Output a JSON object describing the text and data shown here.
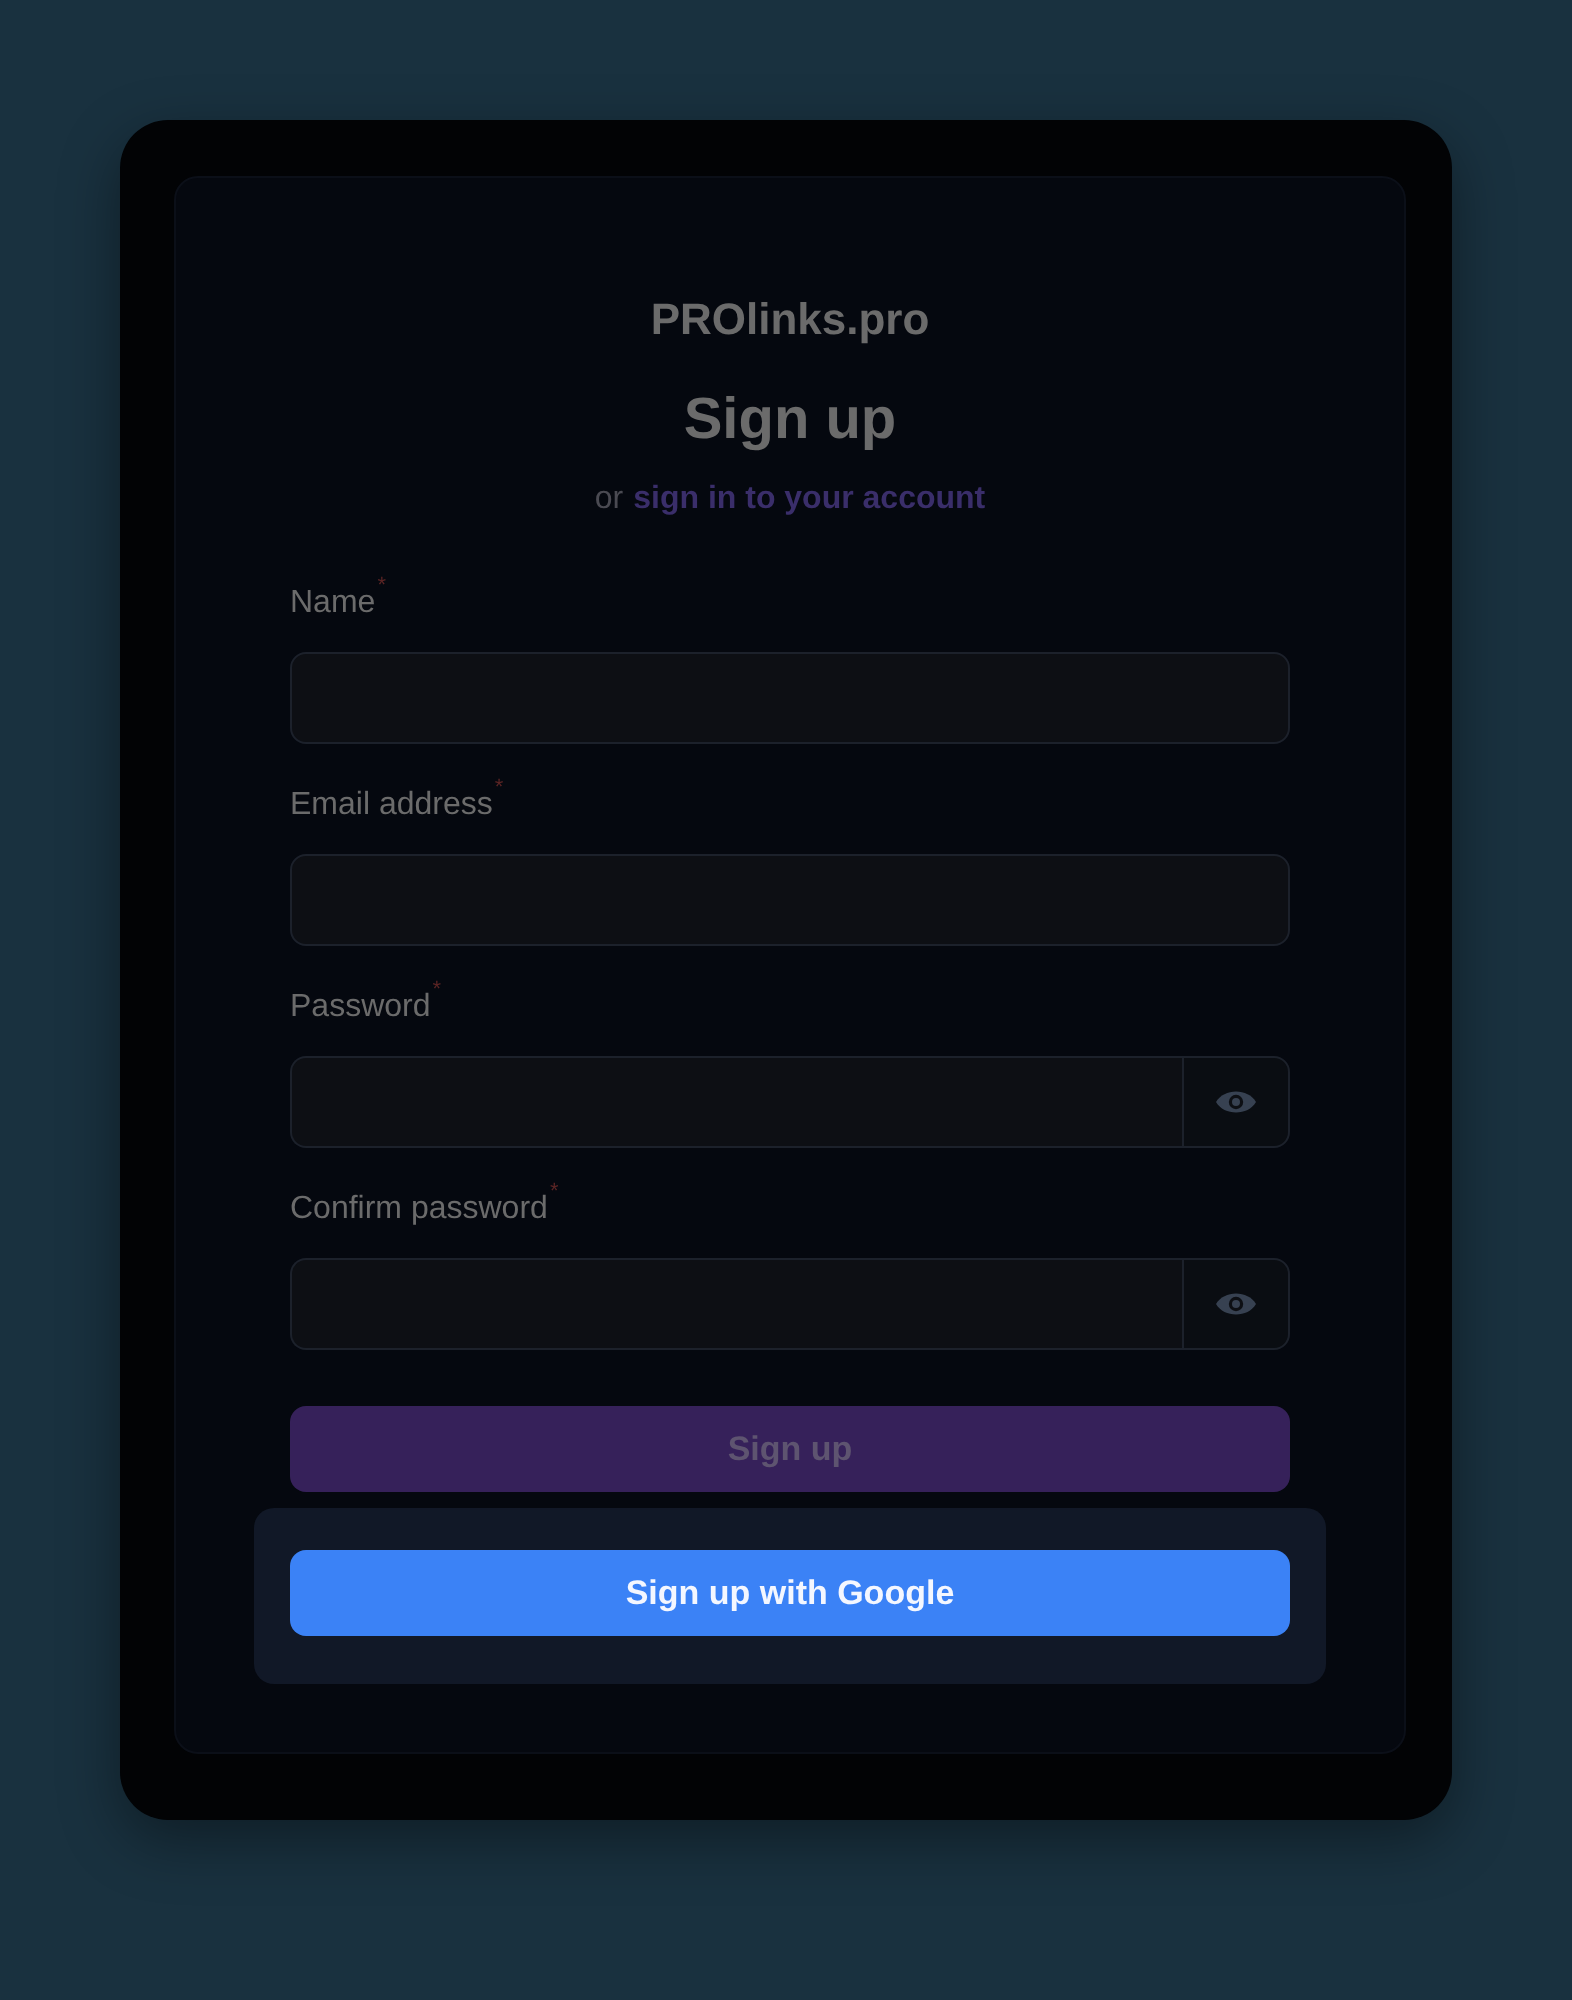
{
  "brand": "PROlinks.pro",
  "title": "Sign up",
  "subtitle": {
    "prefix": "or",
    "link": "sign in to your account"
  },
  "fields": [
    {
      "label": "Name",
      "required_mark": "*",
      "kind": "text"
    },
    {
      "label": "Email address",
      "required_mark": "*",
      "kind": "text"
    },
    {
      "label": "Password",
      "required_mark": "*",
      "kind": "password"
    },
    {
      "label": "Confirm password",
      "required_mark": "*",
      "kind": "password"
    }
  ],
  "submit": {
    "label": "Sign up",
    "disabled": true
  },
  "google": {
    "label": "Sign up with Google"
  }
}
